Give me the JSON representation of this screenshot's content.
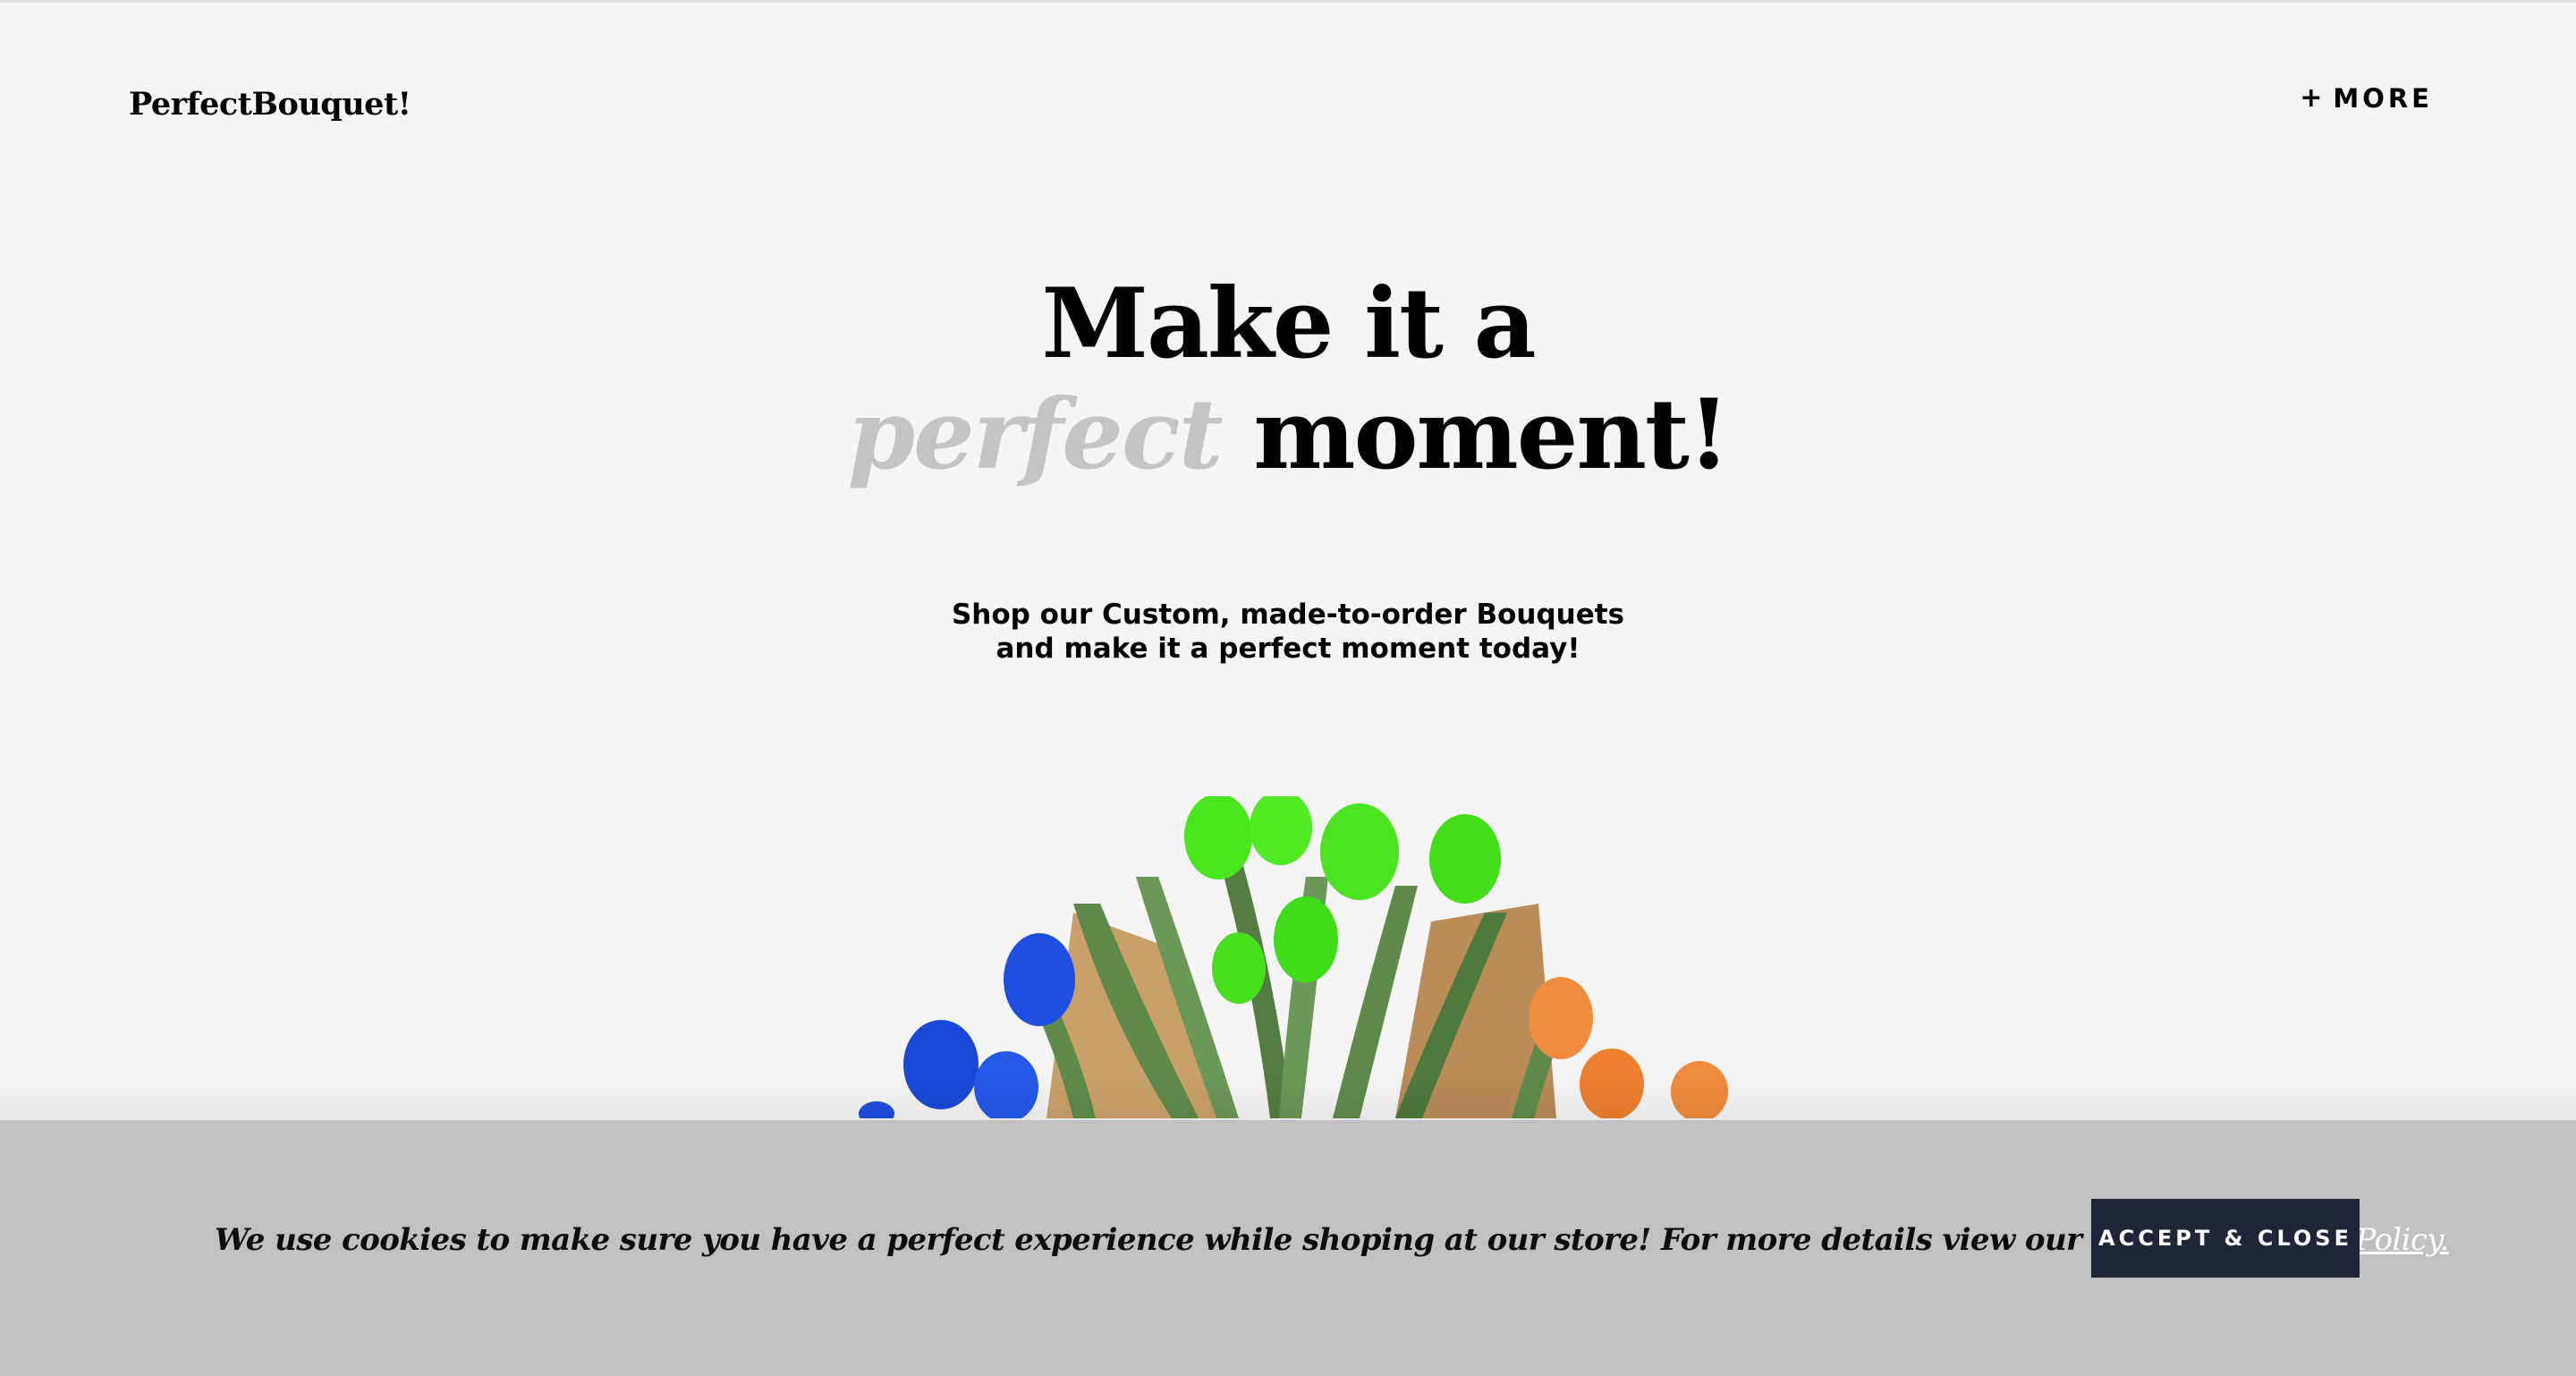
{
  "header": {
    "brand": "PerfectBouquet!",
    "more_icon": "+",
    "more_label": "MORE"
  },
  "hero": {
    "line1": "Make it a",
    "accent_word": "perfect",
    "line2_rest": "moment!"
  },
  "subtitle": {
    "line1": "Shop our Custom, made-to-order Bouquets",
    "line2": "and make it a perfect moment today!"
  },
  "bouquet": {
    "description_icons": [
      "tulip-blue",
      "tulip-green",
      "tulip-orange",
      "kraft-paper-wrap"
    ],
    "colors": {
      "green": "#49e61e",
      "blue": "#1f4fe0",
      "orange": "#f08a3c",
      "leaf": "#5f8a4c",
      "paper": "#c9a06a"
    }
  },
  "cookie_banner": {
    "text": "We use cookies to make sure you have a perfect experience while shoping at our store! For more details view our",
    "link_label": "Terms & Privacy Policy.",
    "accept_label": "ACCEPT & CLOSE"
  },
  "colors": {
    "page_bg": "#f5f5f5",
    "banner_bg": "#c1c1c1",
    "button_bg": "#1f2638",
    "accent_text": "#c4c4c4"
  }
}
